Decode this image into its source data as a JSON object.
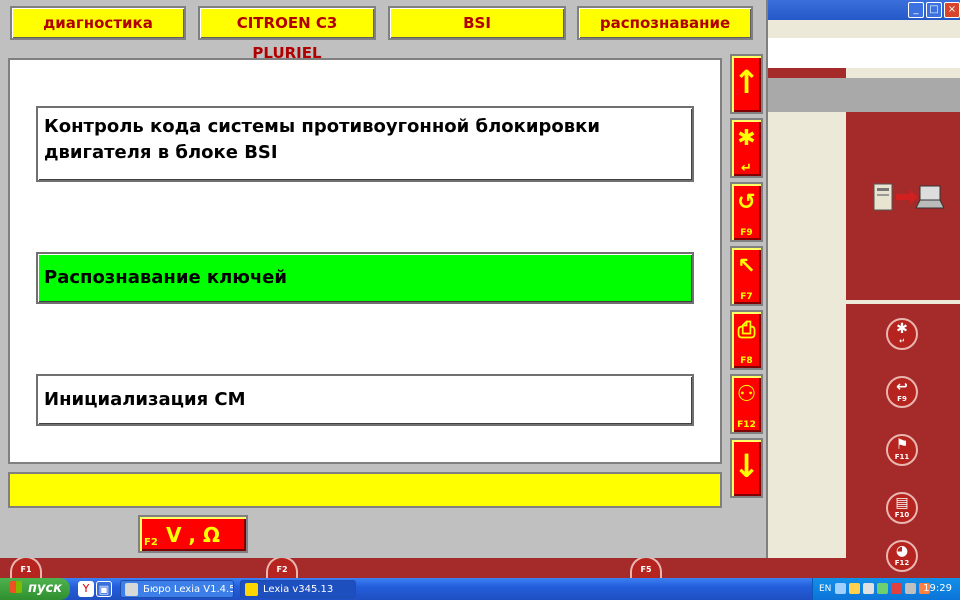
{
  "tabs": [
    "диагностика",
    "CITROEN C3 PLURIEL",
    "BSI",
    "распознавание"
  ],
  "choices": [
    "Контроль кода системы противоугонной блокировки двигателя в блоке BSI",
    "Распознавание ключей",
    "Инициализация CM"
  ],
  "tool_buttons": {
    "scroll_up_icon": "arrow-up",
    "validate_icon": "asterisk-enter",
    "f9": "F9",
    "f7": "F7",
    "f8": "F8",
    "f12": "F12",
    "scroll_down_icon": "arrow-down"
  },
  "measure_button": {
    "fkey": "F2",
    "label": "V , Ω"
  },
  "background_buttons": {
    "side": [
      "F9",
      "F11",
      "F10",
      "F12"
    ],
    "bottom": [
      "F1",
      "F2",
      "F5"
    ]
  },
  "window_controls": [
    "_",
    "□",
    "×"
  ],
  "taskbar": {
    "start_label": "пуск",
    "items": [
      "Бюро Lexia V1.4.5",
      "Lexia v345.13"
    ],
    "language": "EN",
    "clock": "19:29"
  },
  "colors": {
    "tab_bg": "#ffff00",
    "tab_text": "#b00000",
    "selected_choice": "#00ff00",
    "tool_button_bg": "#ff0000",
    "tool_button_fg": "#ffff00",
    "lexia_red": "#a52a2a"
  }
}
